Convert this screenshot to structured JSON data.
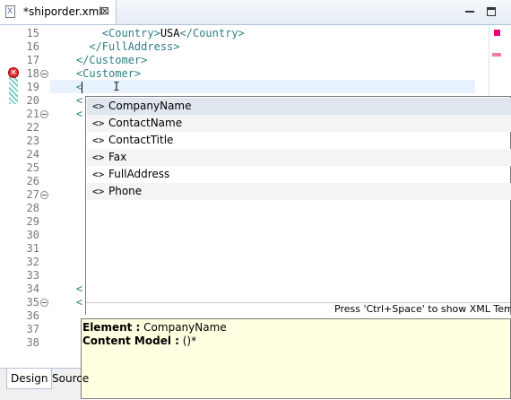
{
  "tab": {
    "title": "*shiporder.xml",
    "close_glyph": "⊠",
    "file_icon": "xml-file-icon"
  },
  "window_buttons": {
    "minimize": "minimize-icon",
    "maximize": "maximize-icon"
  },
  "editor": {
    "lines": [
      {
        "number": "15",
        "segments": [
          [
            "tag",
            "        <Country>"
          ],
          [
            "txt",
            "USA"
          ],
          [
            "tag",
            "</Country>"
          ]
        ]
      },
      {
        "number": "16",
        "segments": [
          [
            "tag",
            "      </FullAddress>"
          ]
        ]
      },
      {
        "number": "17",
        "segments": [
          [
            "tag",
            "    </Customer>"
          ]
        ]
      },
      {
        "number": "18",
        "segments": [
          [
            "tag",
            "    <Customer>"
          ]
        ]
      },
      {
        "number": "19",
        "segments": [
          [
            "tag",
            "    <"
          ]
        ]
      },
      {
        "number": "20",
        "segments": [
          [
            "tag",
            "    <"
          ]
        ]
      },
      {
        "number": "21",
        "segments": [
          [
            "tag",
            "    <"
          ]
        ]
      },
      {
        "number": "22",
        "segments": []
      },
      {
        "number": "23",
        "segments": []
      },
      {
        "number": "24",
        "segments": []
      },
      {
        "number": "25",
        "segments": []
      },
      {
        "number": "26",
        "segments": []
      },
      {
        "number": "27",
        "segments": []
      },
      {
        "number": "28",
        "segments": []
      },
      {
        "number": "29",
        "segments": []
      },
      {
        "number": "30",
        "segments": []
      },
      {
        "number": "31",
        "segments": []
      },
      {
        "number": "32",
        "segments": []
      },
      {
        "number": "33",
        "segments": []
      },
      {
        "number": "34",
        "segments": [
          [
            "tag",
            "    <"
          ]
        ]
      },
      {
        "number": "35",
        "segments": [
          [
            "tag",
            "    <"
          ]
        ]
      },
      {
        "number": "36",
        "segments": []
      },
      {
        "number": "37",
        "segments": []
      },
      {
        "number": "38",
        "segments": []
      }
    ],
    "fold_lines": [
      "18",
      "21",
      "27",
      "35"
    ],
    "error_line": "18",
    "error_icon": "error-icon",
    "colors": {
      "tag": "#2f7f86",
      "current_line": "#e8f2fe",
      "error": "#dd3333"
    }
  },
  "content_assist": {
    "items": [
      {
        "icon": "<>",
        "label": "CompanyName",
        "selected": true
      },
      {
        "icon": "<>",
        "label": "ContactName"
      },
      {
        "icon": "<>",
        "label": "ContactTitle"
      },
      {
        "icon": "<>",
        "label": "Fax"
      },
      {
        "icon": "<>",
        "label": "FullAddress"
      },
      {
        "icon": "<>",
        "label": "Phone"
      }
    ],
    "status": "Press 'Ctrl+Space' to show XML Templa"
  },
  "info_popup": {
    "element_label": "Element :",
    "element_value": " CompanyName",
    "content_model_label": "Content Model :",
    "content_model_value": " ()*"
  },
  "bottom_tabs": [
    {
      "label": "Design",
      "active": true
    },
    {
      "label": "Source",
      "active": false
    }
  ]
}
